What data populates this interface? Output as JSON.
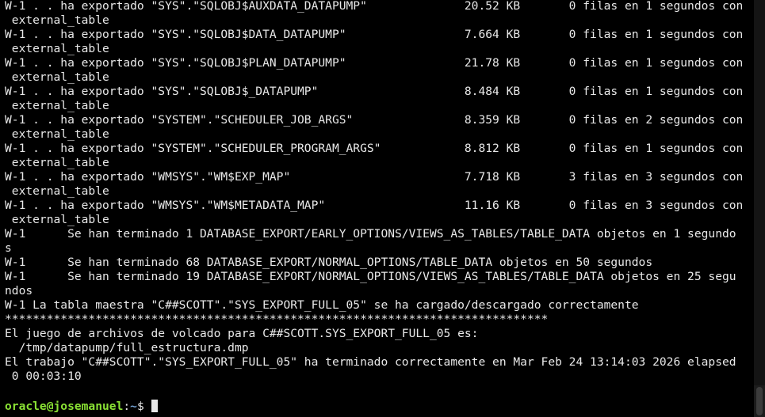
{
  "terminal": {
    "lines": [
      "W-1 . . ha exportado \"SYS\".\"SQLOBJ$AUXDATA_DATAPUMP\"              20.52 KB       0 filas en 1 segundos con",
      " external_table",
      "W-1 . . ha exportado \"SYS\".\"SQLOBJ$DATA_DATAPUMP\"                 7.664 KB       0 filas en 1 segundos con",
      " external_table",
      "W-1 . . ha exportado \"SYS\".\"SQLOBJ$PLAN_DATAPUMP\"                 21.78 KB       0 filas en 1 segundos con",
      " external_table",
      "W-1 . . ha exportado \"SYS\".\"SQLOBJ$_DATAPUMP\"                     8.484 KB       0 filas en 1 segundos con",
      " external_table",
      "W-1 . . ha exportado \"SYSTEM\".\"SCHEDULER_JOB_ARGS\"                8.359 KB       0 filas en 2 segundos con",
      " external_table",
      "W-1 . . ha exportado \"SYSTEM\".\"SCHEDULER_PROGRAM_ARGS\"            8.812 KB       0 filas en 1 segundos con",
      " external_table",
      "W-1 . . ha exportado \"WMSYS\".\"WM$EXP_MAP\"                         7.718 KB       3 filas en 3 segundos con",
      " external_table",
      "W-1 . . ha exportado \"WMSYS\".\"WM$METADATA_MAP\"                    11.16 KB       0 filas en 3 segundos con",
      " external_table",
      "W-1      Se han terminado 1 DATABASE_EXPORT/EARLY_OPTIONS/VIEWS_AS_TABLES/TABLE_DATA objetos en 1 segundo",
      "s",
      "W-1      Se han terminado 68 DATABASE_EXPORT/NORMAL_OPTIONS/TABLE_DATA objetos en 50 segundos",
      "W-1      Se han terminado 19 DATABASE_EXPORT/NORMAL_OPTIONS/VIEWS_AS_TABLES/TABLE_DATA objetos en 25 segu",
      "ndos",
      "W-1 La tabla maestra \"C##SCOTT\".\"SYS_EXPORT_FULL_05\" se ha cargado/descargado correctamente",
      "******************************************************************************",
      "El juego de archivos de volcado para C##SCOTT.SYS_EXPORT_FULL_05 es:",
      "  /tmp/datapump/full_estructura.dmp",
      "El trabajo \"C##SCOTT\".\"SYS_EXPORT_FULL_05\" ha terminado correctamente en Mar Feb 24 13:14:03 2026 elapsed",
      " 0 00:03:10",
      ""
    ],
    "prompt": {
      "user_host": "oracle@josemanuel",
      "separator": ":",
      "path": "~",
      "sign": "$ "
    }
  },
  "colors": {
    "background": "#000000",
    "text": "#e8e8e8",
    "prompt_user": "#8ae234",
    "prompt_path": "#729fcf"
  }
}
